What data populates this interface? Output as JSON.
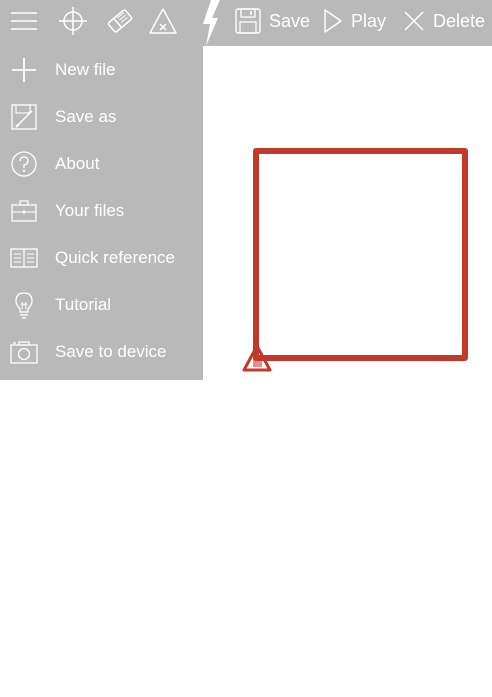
{
  "toolbar": {
    "tools": [
      {
        "name": "menu-icon"
      },
      {
        "name": "crosshair-icon"
      },
      {
        "name": "eraser-icon"
      },
      {
        "name": "clear-turtle-icon"
      }
    ],
    "save_label": "Save",
    "play_label": "Play",
    "delete_label": "Delete"
  },
  "menu": {
    "items": [
      {
        "label": "New file",
        "icon": "plus-icon"
      },
      {
        "label": "Save as",
        "icon": "save-as-icon"
      },
      {
        "label": "About",
        "icon": "question-icon"
      },
      {
        "label": "Your files",
        "icon": "briefcase-icon"
      },
      {
        "label": "Quick reference",
        "icon": "book-icon"
      },
      {
        "label": "Tutorial",
        "icon": "lightbulb-icon"
      },
      {
        "label": "Save to device",
        "icon": "camera-icon"
      }
    ]
  },
  "colors": {
    "toolbar_bg": "#b9b9b9",
    "drawing_stroke": "#c0392b",
    "icon_white": "#ffffff"
  }
}
